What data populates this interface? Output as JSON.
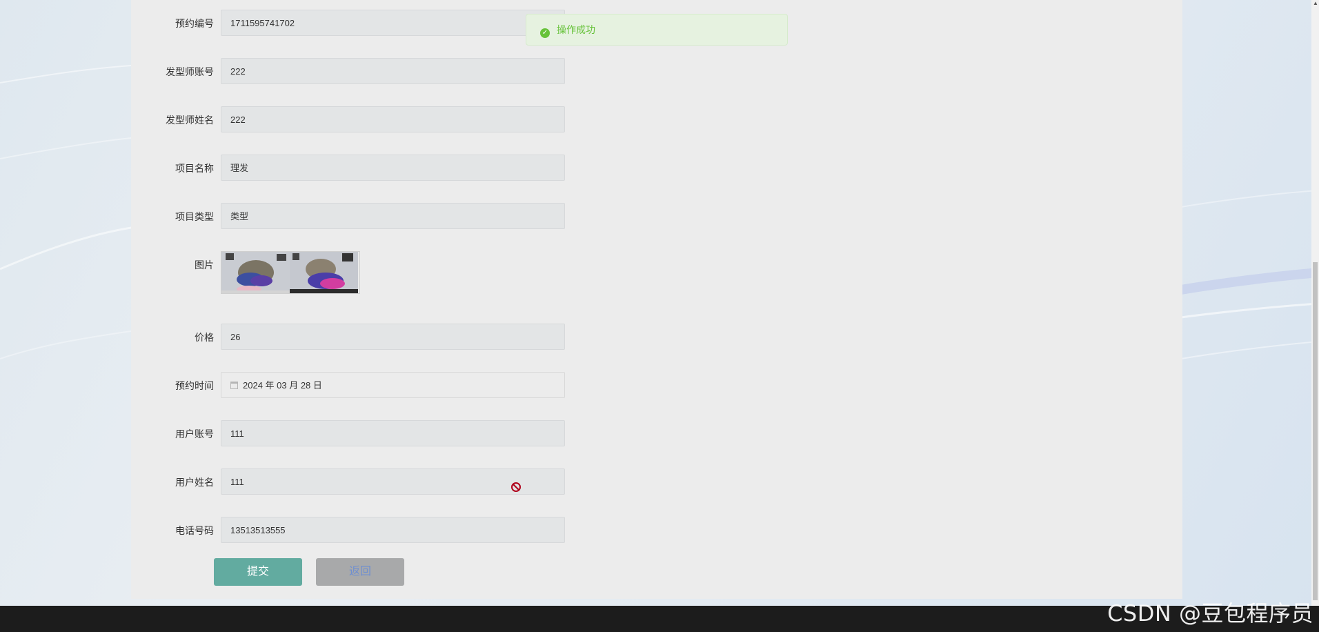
{
  "form": {
    "fields": [
      {
        "label": "预约编号",
        "value": "1711595741702"
      },
      {
        "label": "发型师账号",
        "value": "222"
      },
      {
        "label": "发型师姓名",
        "value": "222"
      },
      {
        "label": "项目名称",
        "value": "理发"
      },
      {
        "label": "项目类型",
        "value": "类型"
      }
    ],
    "image_label": "图片",
    "price_label": "价格",
    "price_value": "26",
    "date_label": "预约时间",
    "date_value": "2024 年 03 月 28 日",
    "user_account_label": "用户账号",
    "user_account_value": "111",
    "user_name_label": "用户姓名",
    "user_name_value": "111",
    "phone_label": "电话号码",
    "phone_value": "13513513555"
  },
  "buttons": {
    "submit": "提交",
    "back": "返回"
  },
  "toast": {
    "message": "操作成功",
    "icon": "check-circle-icon",
    "color": "#67c23a"
  },
  "watermark": "CSDN @豆包程序员",
  "colors": {
    "accent": "#62aba0",
    "back_button": "#a8a9aa",
    "success": "#67c23a"
  }
}
